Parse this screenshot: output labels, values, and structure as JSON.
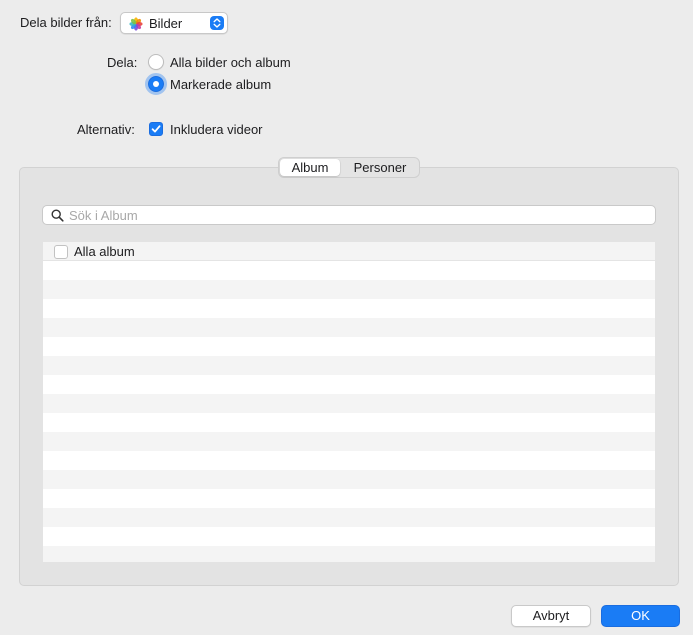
{
  "source": {
    "label": "Dela bilder från:",
    "selected": "Bilder",
    "icon": "photos-app-icon"
  },
  "share": {
    "label": "Dela:",
    "options": [
      {
        "label": "Alla bilder och album",
        "selected": false
      },
      {
        "label": "Markerade album",
        "selected": true
      }
    ]
  },
  "options": {
    "label": "Alternativ:",
    "include_videos": {
      "label": "Inkludera videor",
      "checked": true
    }
  },
  "tabs": [
    {
      "label": "Album",
      "selected": true
    },
    {
      "label": "Personer",
      "selected": false
    }
  ],
  "search": {
    "placeholder": "Sök i Album",
    "value": ""
  },
  "list": {
    "items": [
      {
        "label": "Alla album",
        "checked": false
      }
    ]
  },
  "buttons": {
    "cancel": "Avbryt",
    "ok": "OK"
  },
  "colors": {
    "accent": "#1a7cf5",
    "background": "#ececec"
  }
}
